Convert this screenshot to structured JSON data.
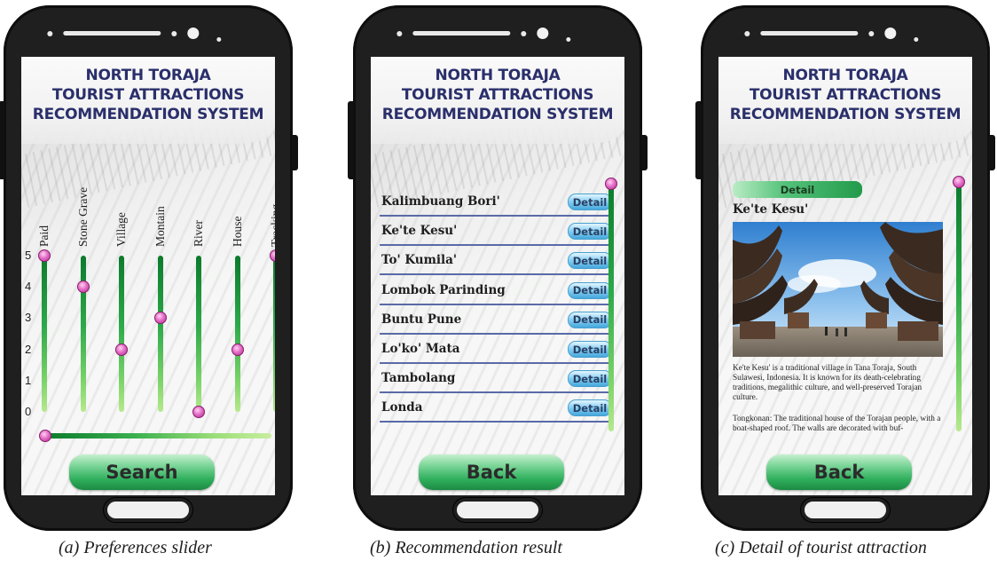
{
  "app_title": [
    "NORTH TORAJA",
    "TOURIST ATTRACTIONS",
    "RECOMMENDATION SYSTEM"
  ],
  "screen_a": {
    "columns": [
      {
        "label": "Paid",
        "value": 5
      },
      {
        "label": "Stone Grave",
        "value": 4
      },
      {
        "label": "Village",
        "value": 2
      },
      {
        "label": "Montain",
        "value": 3
      },
      {
        "label": "River",
        "value": 0
      },
      {
        "label": "House",
        "value": 2
      },
      {
        "label": "Tracking",
        "value": 5
      }
    ],
    "scale_labels": [
      "5",
      "4",
      "3",
      "2",
      "1",
      "0"
    ],
    "horizontal_slider_value": 0,
    "search_label": "Search",
    "caption": "(a)  Preferences slider"
  },
  "screen_b": {
    "items": [
      {
        "name": "Kalimbuang Bori'",
        "button": "Detail"
      },
      {
        "name": "Ke'te Kesu'",
        "button": "Detail"
      },
      {
        "name": "To' Kumila'",
        "button": "Detail"
      },
      {
        "name": "Lombok Parinding",
        "button": "Detail"
      },
      {
        "name": "Buntu Pune",
        "button": "Detail"
      },
      {
        "name": "Lo'ko' Mata",
        "button": "Detail"
      },
      {
        "name": "Tambolang",
        "button": "Detail"
      },
      {
        "name": "Londa",
        "button": "Detail"
      }
    ],
    "back_label": "Back",
    "caption": "(b)  Recommendation result"
  },
  "screen_c": {
    "tab_label": "Detail",
    "name": "Ke'te Kesu'",
    "description_1": "Ke'te Kesu' is a traditional village in Tana Toraja, South Sulawesi, Indonesia. It is known for its death-celebrating traditions, megalithic culture, and well-preserved Torajan culture.",
    "description_2": "Tongkonan: The traditional house of the Torajan people, with a boat-shaped roof. The walls are decorated with buf-",
    "back_label": "Back",
    "caption": "(c)  Detail of tourist attraction"
  },
  "colors": {
    "title": "#2a2f6b",
    "slider_green": "#2da94a",
    "knob_pink": "#e46fc8",
    "detail_blue": "#45a8dc",
    "row_line": "#5a6aa8"
  }
}
